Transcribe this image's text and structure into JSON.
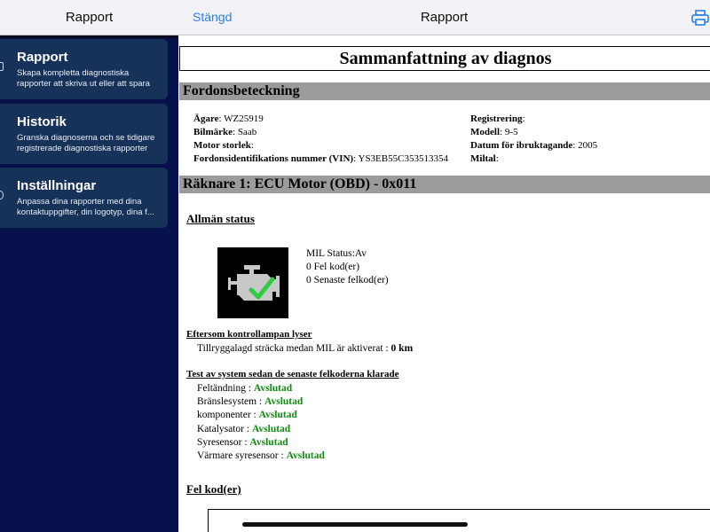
{
  "sidebar": {
    "title": "Rapport",
    "items": [
      {
        "title": "Rapport",
        "desc": "Skapa kompletta diagnostiska rapporter att skriva ut eller att spara"
      },
      {
        "title": "Historik",
        "desc": "Granska diagnoserna och se tidigare registrerade diagnostiska rapporter"
      },
      {
        "title": "Inställningar",
        "desc": "Anpassa dina rapporter med dina kontaktuppgifter, din logotyp, dina f..."
      }
    ]
  },
  "nav": {
    "close_label": "Stängd",
    "title": "Rapport",
    "print_icon": "printer-icon"
  },
  "report": {
    "title": "Sammanfattning av diagnos",
    "vehicle_section": "Fordonsbeteckning",
    "vehicle": {
      "owner_label": "Ägare",
      "owner": "WZ25919",
      "brand_label": "Bilmärke",
      "brand": "Saab",
      "engine_label": "Motor storlek",
      "engine": "",
      "vin_label": "Fordonsidentifikations nummer (VIN)",
      "vin": "YS3EB55C353513354",
      "reg_label": "Registrering",
      "reg": "",
      "model_label": "Modell",
      "model": "9-5",
      "date_label": "Datum för ibruktagande",
      "date": "2005",
      "mileage_label": "Miltal",
      "mileage": ""
    },
    "counter_section": "Räknare 1: ECU Motor (OBD) - 0x011",
    "general_status": "Allmän status",
    "mil_status": "MIL Status:Av",
    "fault_codes": "0 Fel kod(er)",
    "recent_codes": "0 Senaste felkod(er)",
    "lamp_heading": "Eftersom kontrollampan lyser",
    "distance_label": "Tillryggalagd sträcka medan MIL är aktiverat :",
    "distance_value": "0 km",
    "tests_heading": "Test av system sedan de senaste felkoderna klarade",
    "tests": [
      {
        "label": "Feltändning :",
        "status": "Avslutad"
      },
      {
        "label": "Bränslesystem :",
        "status": "Avslutad"
      },
      {
        "label": "komponenter :",
        "status": "Avslutad"
      },
      {
        "label": "Katalysator :",
        "status": "Avslutad"
      },
      {
        "label": "Syresensor :",
        "status": "Avslutad"
      },
      {
        "label": "Värmare syresensor :",
        "status": "Avslutad"
      }
    ],
    "fault_heading": "Fel kod(er)"
  },
  "colors": {
    "sidebar_bg": "#06104a",
    "card_bg": "#173259",
    "accent": "#2a7fe3",
    "ok": "#138a13",
    "section_bar": "#9b9b9b"
  }
}
